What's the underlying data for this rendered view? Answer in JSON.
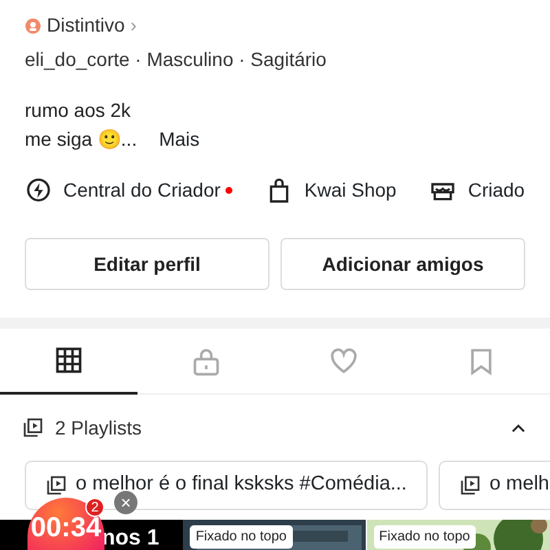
{
  "badge_link": {
    "label": "Distintivo",
    "chevron": "›"
  },
  "profile_meta": "eli_do_corte · Masculino · Sagitário",
  "bio": {
    "lines": [
      "rumo aos 2k",
      "me siga 🙂..."
    ],
    "more": "Mais"
  },
  "shortcuts": [
    {
      "kind": "bolt",
      "label": "Central do Criador",
      "dot": true
    },
    {
      "kind": "bag",
      "label": "Kwai Shop",
      "dot": false
    },
    {
      "kind": "store",
      "label": "Criado",
      "dot": false
    }
  ],
  "buttons": [
    "Editar perfil",
    "Adicionar amigos"
  ],
  "tabs": [
    {
      "kind": "grid",
      "selected": true
    },
    {
      "kind": "lock",
      "selected": false
    },
    {
      "kind": "heart",
      "selected": false
    },
    {
      "kind": "bookmark",
      "selected": false
    }
  ],
  "playlists": {
    "title": "2 Playlists",
    "expanded": true,
    "items": [
      "o melhor é o final ksksks #Comédia...",
      "o melh"
    ]
  },
  "videos": [
    {
      "kind": "dark",
      "caption": "nos 1"
    },
    {
      "kind": "call",
      "pinned": "Fixado no topo"
    },
    {
      "kind": "nature",
      "pinned": "Fixado no topo"
    }
  ],
  "timer": {
    "time": "00:34",
    "count": "2",
    "close": "×"
  }
}
